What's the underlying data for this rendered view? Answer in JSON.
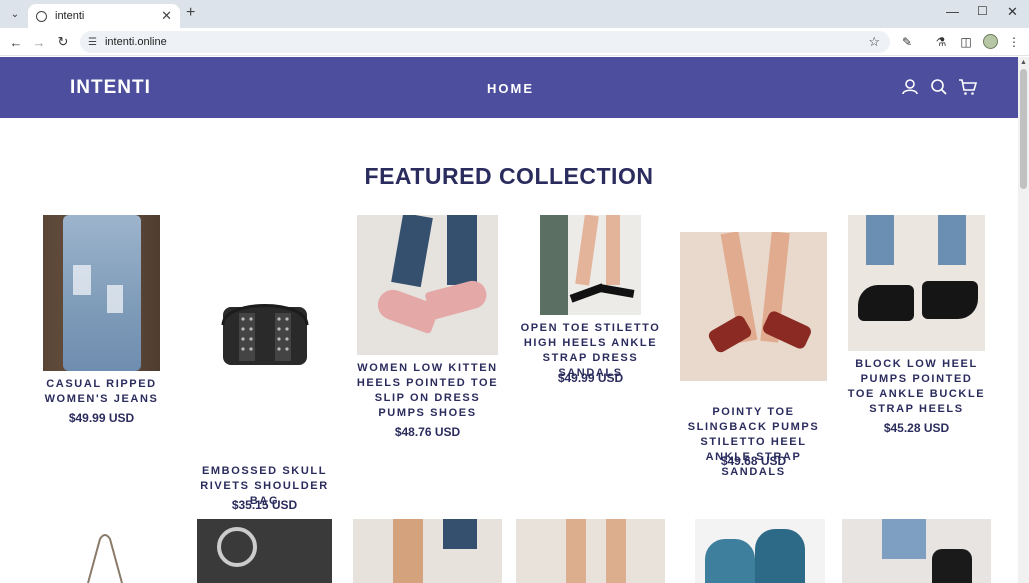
{
  "browser": {
    "tab_title": "intenti",
    "url": "intenti.online"
  },
  "site": {
    "logo": "INTENTI",
    "nav_home": "HOME",
    "section_title": "FEATURED COLLECTION",
    "brand_color": "#4d4f9e",
    "text_color": "#2b2c5e"
  },
  "products": [
    {
      "name": "CASUAL RIPPED WOMEN'S JEANS",
      "price": "$49.99 USD"
    },
    {
      "name": "EMBOSSED SKULL RIVETS SHOULDER BAG",
      "price": "$35.15 USD"
    },
    {
      "name": "WOMEN LOW KITTEN HEELS POINTED TOE SLIP ON DRESS PUMPS SHOES",
      "price": "$48.76 USD"
    },
    {
      "name": "OPEN TOE STILETTO HIGH HEELS ANKLE STRAP DRESS SANDALS",
      "price": "$49.99 USD"
    },
    {
      "name": "POINTY TOE SLINGBACK PUMPS STILETTO HEEL ANKLE STRAP SANDALS",
      "price": "$49.68 USD"
    },
    {
      "name": "BLOCK LOW HEEL PUMPS POINTED TOE ANKLE BUCKLE STRAP HEELS",
      "price": "$45.28 USD"
    }
  ]
}
